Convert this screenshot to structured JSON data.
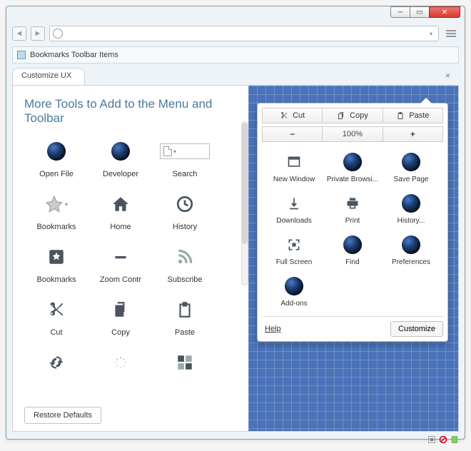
{
  "window": {
    "bookmarks_bar_label": "Bookmarks Toolbar Items",
    "tab_label": "Customize UX"
  },
  "left": {
    "heading": "More Tools to Add to the Menu and Toolbar",
    "restore_label": "Restore Defaults",
    "tools": [
      {
        "label": "Open File",
        "icon": "sphere"
      },
      {
        "label": "Developer",
        "icon": "sphere"
      },
      {
        "label": "Search",
        "icon": "search-field"
      },
      {
        "label": "Bookmarks",
        "icon": "star"
      },
      {
        "label": "Home",
        "icon": "home"
      },
      {
        "label": "History",
        "icon": "clock"
      },
      {
        "label": "Bookmarks",
        "icon": "bookmark-solid"
      },
      {
        "label": "Zoom Contr",
        "icon": "minus"
      },
      {
        "label": "Subscribe",
        "icon": "rss"
      },
      {
        "label": "Cut",
        "icon": "scissors"
      },
      {
        "label": "Copy",
        "icon": "copy"
      },
      {
        "label": "Paste",
        "icon": "clipboard"
      },
      {
        "label": "",
        "icon": "sync"
      },
      {
        "label": "",
        "icon": "spinner"
      },
      {
        "label": "",
        "icon": "tiles"
      }
    ]
  },
  "panel": {
    "edit": {
      "cut": "Cut",
      "copy": "Copy",
      "paste": "Paste"
    },
    "zoom": {
      "minus": "−",
      "value": "100%",
      "plus": "+"
    },
    "items": [
      {
        "label": "New Window",
        "icon": "window"
      },
      {
        "label": "Private Browsi...",
        "icon": "sphere"
      },
      {
        "label": "Save Page",
        "icon": "sphere"
      },
      {
        "label": "Downloads",
        "icon": "download"
      },
      {
        "label": "Print",
        "icon": "print"
      },
      {
        "label": "History...",
        "icon": "sphere"
      },
      {
        "label": "Full Screen",
        "icon": "fullscreen"
      },
      {
        "label": "Find",
        "icon": "sphere"
      },
      {
        "label": "Preferences",
        "icon": "sphere"
      },
      {
        "label": "Add-ons",
        "icon": "sphere"
      }
    ],
    "help_label": "Help",
    "customize_label": "Customize"
  }
}
